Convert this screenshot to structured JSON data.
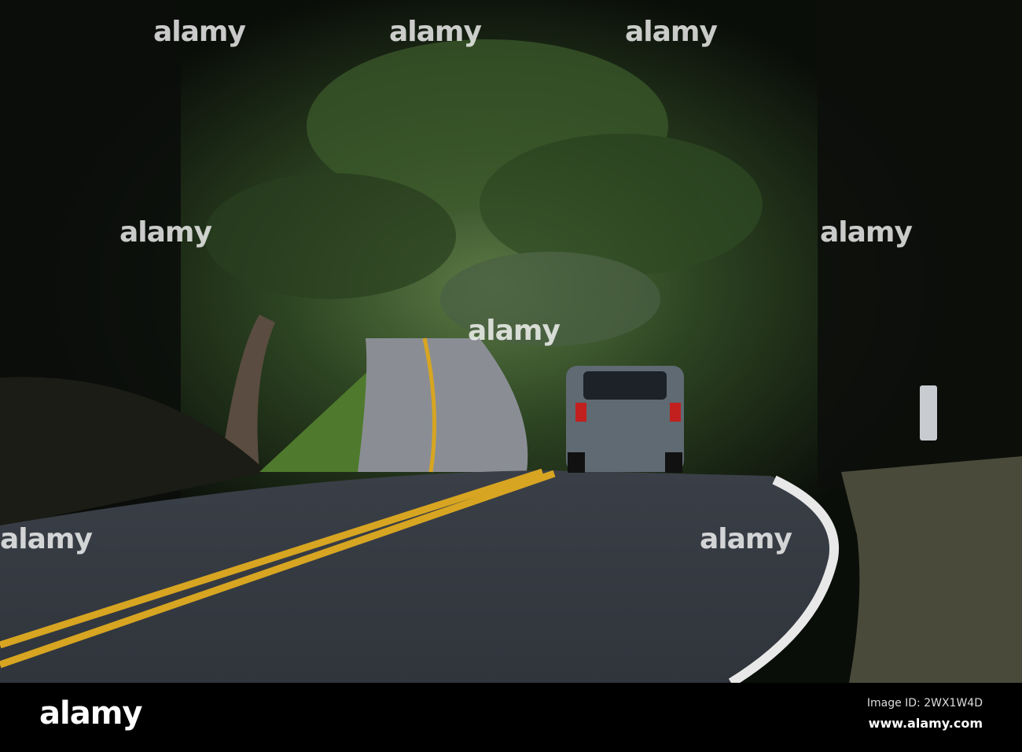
{
  "watermark": {
    "text": "alamy"
  },
  "footer": {
    "logo": "alamy",
    "image_id": "Image ID: 2WX1W4D",
    "website": "www.alamy.com"
  },
  "colors": {
    "road": "#2b2f36",
    "center_line": "#d7a521",
    "foliage": "#2f4a23",
    "background": "#000000"
  }
}
